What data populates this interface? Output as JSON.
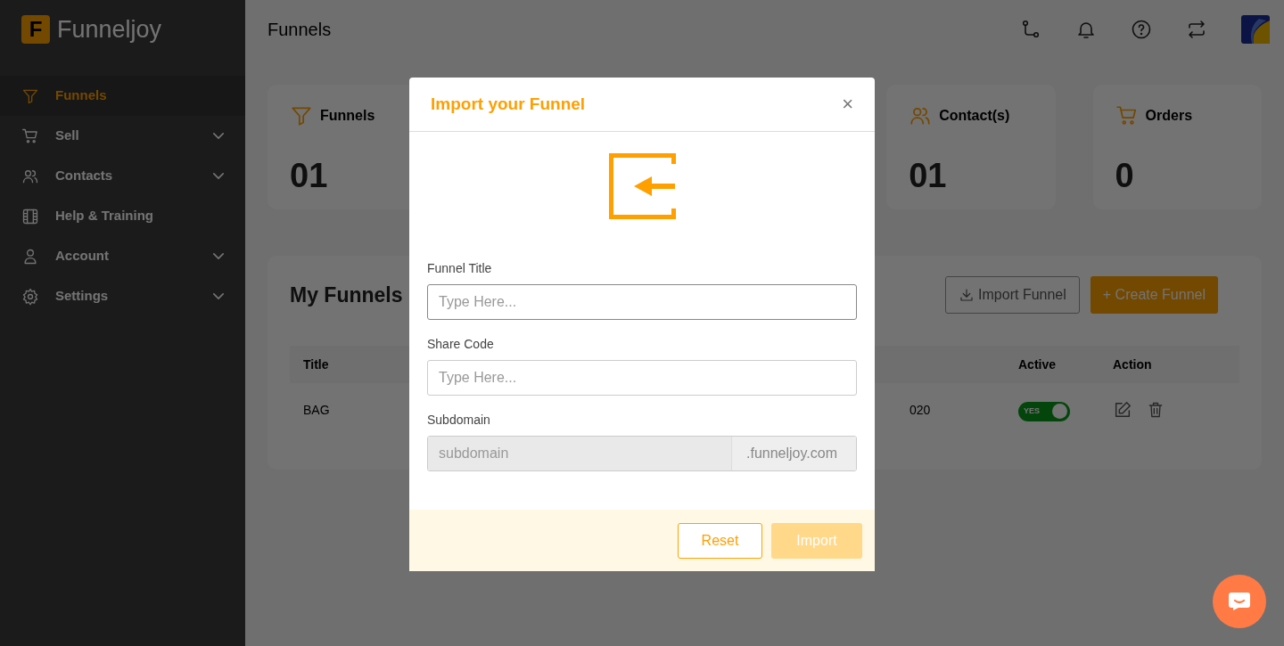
{
  "brand": {
    "letter": "F",
    "name": "Funneljoy"
  },
  "sidebar": {
    "items": [
      {
        "label": "Funnels",
        "selected": true,
        "has_submenu": false
      },
      {
        "label": "Sell",
        "selected": false,
        "has_submenu": true
      },
      {
        "label": "Contacts",
        "selected": false,
        "has_submenu": true
      },
      {
        "label": "Help & Training",
        "selected": false,
        "has_submenu": false
      },
      {
        "label": "Account",
        "selected": false,
        "has_submenu": true
      },
      {
        "label": "Settings",
        "selected": false,
        "has_submenu": true
      }
    ]
  },
  "header": {
    "title": "Funnels"
  },
  "stats": [
    {
      "label": "Funnels",
      "value": "01"
    },
    {
      "label": "Contact(s)",
      "value": "01"
    },
    {
      "label": "Orders",
      "value": "0"
    }
  ],
  "funnels_panel": {
    "title": "My Funnels",
    "import_button": "Import Funnel",
    "create_button": "+ Create Funnel",
    "table": {
      "columns": [
        "Title",
        "Active",
        "Action"
      ],
      "rows": [
        {
          "title": "BAG",
          "column_2": "020",
          "active": true,
          "active_label": "YES"
        }
      ]
    }
  },
  "modal": {
    "title": "Import your Funnel",
    "close": "×",
    "fields": [
      {
        "label": "Funnel Title",
        "placeholder": "Type Here...",
        "kind": "text",
        "focused": true
      },
      {
        "label": "Share Code",
        "placeholder": "Type Here...",
        "kind": "text",
        "focused": false
      },
      {
        "label": "Subdomain",
        "placeholder": "subdomain",
        "kind": "addon",
        "addon": ".funneljoy.com",
        "disabled": true
      }
    ],
    "buttons": [
      {
        "label": "Reset",
        "kind": "outline",
        "disabled": false
      },
      {
        "label": "Import",
        "kind": "primary",
        "disabled": true
      }
    ]
  }
}
